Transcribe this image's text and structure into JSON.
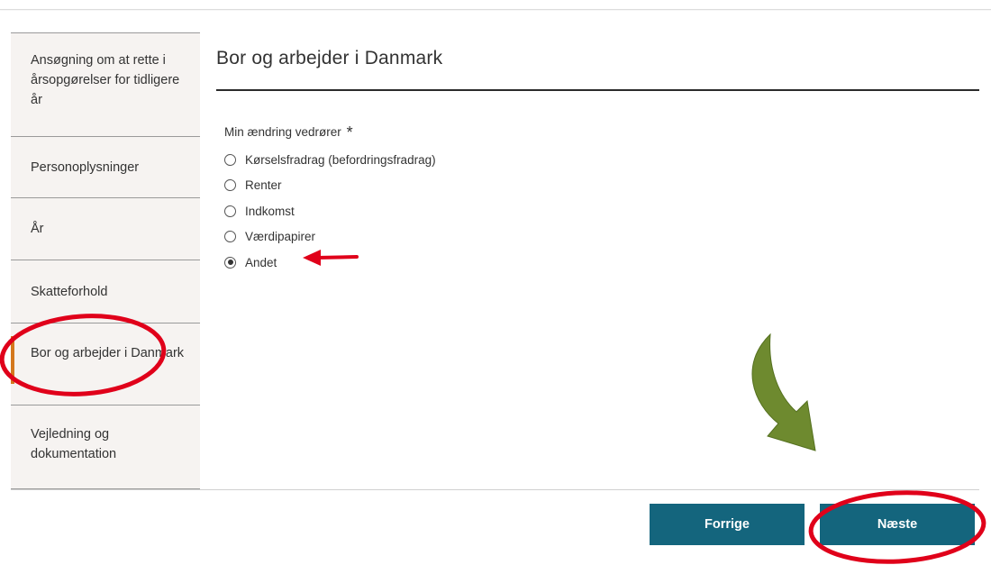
{
  "sidebar": {
    "items": [
      {
        "label": "Ansøgning om at rette i årsopgørelser for tidligere år"
      },
      {
        "label": "Personoplysninger"
      },
      {
        "label": "År"
      },
      {
        "label": "Skatteforhold"
      },
      {
        "label": "Bor og arbejder i Danmark",
        "active": true
      },
      {
        "label": "Vejledning og dokumentation"
      }
    ]
  },
  "main": {
    "title": "Bor og arbejder i Danmark",
    "field_label": "Min ændring vedrører",
    "required_mark": "*",
    "options": [
      {
        "label": "Kørselsfradrag (befordringsfradrag)",
        "checked": false
      },
      {
        "label": "Renter",
        "checked": false
      },
      {
        "label": "Indkomst",
        "checked": false
      },
      {
        "label": "Værdipapirer",
        "checked": false
      },
      {
        "label": "Andet",
        "checked": true
      }
    ]
  },
  "footer": {
    "prev_label": "Forrige",
    "next_label": "Næste"
  },
  "colors": {
    "sidebar_bg": "#f6f3f1",
    "active_marker": "#d4781e",
    "button_bg": "#14657d",
    "annotation_red": "#e0001a",
    "annotation_green": "#6e8a2f"
  }
}
